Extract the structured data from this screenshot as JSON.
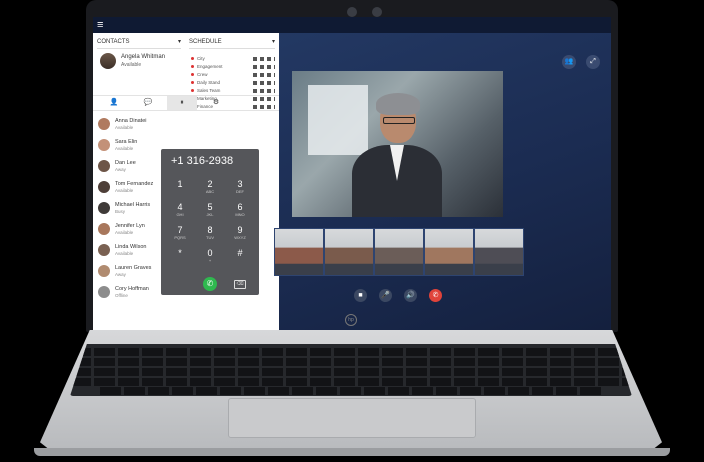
{
  "contacts_panel": {
    "left_selector": "CONTACTS",
    "right_selector": "SCHEDULE",
    "me": {
      "name": "Angela Whitman",
      "status": "Available"
    },
    "mini_list": [
      "City",
      "Engagement",
      "Crew",
      "Daily Stand",
      "Sales Team",
      "Marketing",
      "Finance"
    ],
    "tabs": [
      "👤",
      "💬",
      "⏸",
      "⚙"
    ],
    "contacts": [
      {
        "name": "Anna Dinatei",
        "status": "Available",
        "color": "#b07a5f"
      },
      {
        "name": "Sara Elin",
        "status": "Available",
        "color": "#c39178"
      },
      {
        "name": "Dan Lee",
        "status": "Away",
        "color": "#6d5547"
      },
      {
        "name": "Tom Fernandez",
        "status": "Available",
        "color": "#4e3f38"
      },
      {
        "name": "Michael Harris",
        "status": "Busy",
        "color": "#3f3a38"
      },
      {
        "name": "Jennifer Lyn",
        "status": "Available",
        "color": "#a8775c"
      },
      {
        "name": "Linda Wilson",
        "status": "Available",
        "color": "#7a6152"
      },
      {
        "name": "Lauren Graves",
        "status": "Away",
        "color": "#b08b70"
      },
      {
        "name": "Cory Hoffman",
        "status": "Offline",
        "color": "#8c8c8c"
      }
    ]
  },
  "dialer": {
    "number": "+1 316-2938",
    "keys": [
      {
        "d": "1",
        "l": ""
      },
      {
        "d": "2",
        "l": "ABC"
      },
      {
        "d": "3",
        "l": "DEF"
      },
      {
        "d": "4",
        "l": "GHI"
      },
      {
        "d": "5",
        "l": "JKL"
      },
      {
        "d": "6",
        "l": "MNO"
      },
      {
        "d": "7",
        "l": "PQRS"
      },
      {
        "d": "8",
        "l": "TUV"
      },
      {
        "d": "9",
        "l": "WXYZ"
      },
      {
        "d": "*",
        "l": ""
      },
      {
        "d": "0",
        "l": "+"
      },
      {
        "d": "#",
        "l": ""
      }
    ],
    "call_icon": "✆",
    "delete_icon": "⌫"
  },
  "video": {
    "thumbnail_colors": [
      "#8c5a4a",
      "#7a5b4c",
      "#6b5d58",
      "#a0775f",
      "#4e4d55"
    ],
    "controls": [
      "■",
      "🎤",
      "🔊",
      "✆"
    ],
    "end_call_color": "#e0433a"
  },
  "top_right": [
    "👥",
    "⤢"
  ],
  "brand": "hp"
}
